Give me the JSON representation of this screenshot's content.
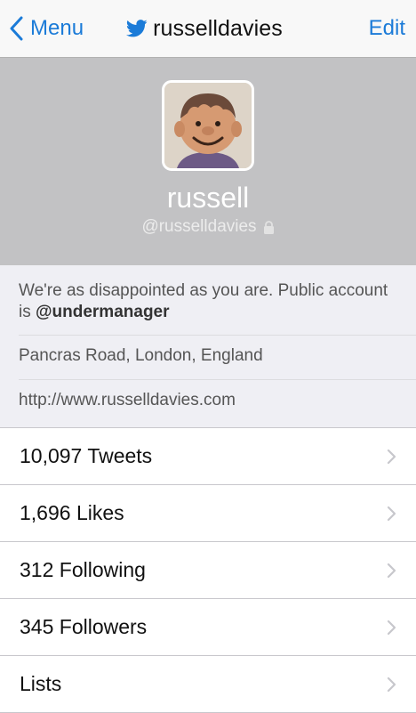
{
  "navbar": {
    "back_label": "Menu",
    "title": "russelldavies",
    "edit_label": "Edit",
    "accent_color": "#1b7bd8",
    "title_icon": "twitter-bird-icon"
  },
  "profile": {
    "name": "russell",
    "handle": "@russelldavies",
    "protected_icon": "lock-icon"
  },
  "bio": {
    "text_prefix": "We're as disappointed as you are. Public account is ",
    "text_mention": "@undermanager",
    "location": "Pancras Road, London, England",
    "url": "http://www.russelldavies.com"
  },
  "stats": {
    "items": [
      {
        "label": "10,097 Tweets"
      },
      {
        "label": "1,696 Likes"
      },
      {
        "label": "312 Following"
      },
      {
        "label": "345 Followers"
      },
      {
        "label": "Lists"
      }
    ]
  }
}
